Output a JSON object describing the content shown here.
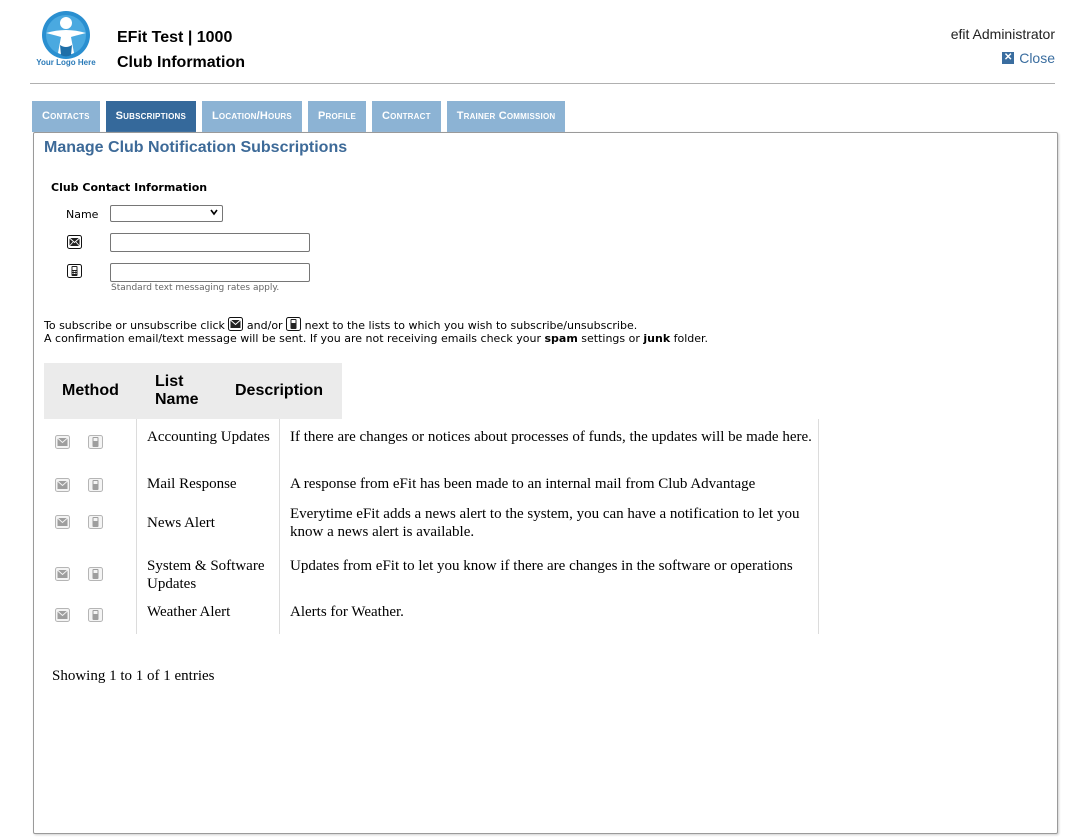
{
  "header": {
    "logo_text": "Your Logo Here",
    "club_name": "EFit Test | 1000",
    "page_title": "Club Information",
    "user": "efit Administrator",
    "close_label": "Close"
  },
  "tabs": [
    {
      "label": "Contacts",
      "active": false
    },
    {
      "label": "Subscriptions",
      "active": true
    },
    {
      "label": "Location/Hours",
      "active": false
    },
    {
      "label": "Profile",
      "active": false
    },
    {
      "label": "Contract",
      "active": false
    },
    {
      "label": "Trainer Commission",
      "active": false
    }
  ],
  "panel": {
    "title": "Manage Club Notification Subscriptions",
    "contact_heading": "Club Contact Information",
    "name_label": "Name",
    "name_value": "",
    "email_value": "",
    "sms_value": "",
    "sms_note": "Standard text messaging rates apply.",
    "instructions": {
      "line1_a": "To subscribe or unsubscribe click ",
      "line1_b": " and/or ",
      "line1_c": " next to the lists to which you wish to subscribe/unsubscribe.",
      "line2_a": "A confirmation email/text message will be sent. If you are not receiving emails check your ",
      "line2_spam": "spam",
      "line2_b": " settings or ",
      "line2_junk": "junk",
      "line2_c": " folder."
    }
  },
  "table": {
    "headers": {
      "method": "Method",
      "list_name_1": "List",
      "list_name_2": "Name",
      "description": "Description"
    },
    "rows": [
      {
        "list_name": "Accounting Updates",
        "description": "If there are changes or notices about processes of funds, the updates will be made here."
      },
      {
        "list_name": "Mail Response",
        "description": "A response from eFit has been made to an internal mail from Club Advantage"
      },
      {
        "list_name": "News Alert",
        "description": "Everytime eFit adds a news alert to the system, you can have a notification to let you know a news alert is available."
      },
      {
        "list_name": "System & Software Updates",
        "description": "Updates from eFit to let you know if there are changes in the software or operations"
      },
      {
        "list_name": "Weather Alert",
        "description": "Alerts for Weather."
      }
    ],
    "entries_text": "Showing 1 to 1 of 1 entries"
  },
  "icons": {
    "email": "envelope-icon",
    "sms": "mobile-phone-icon",
    "close": "close-icon"
  },
  "colors": {
    "tab_inactive": "#8cb3d4",
    "tab_active": "#35699b",
    "title_blue": "#3d6a98",
    "logo_blue": "#2a7ab8"
  }
}
